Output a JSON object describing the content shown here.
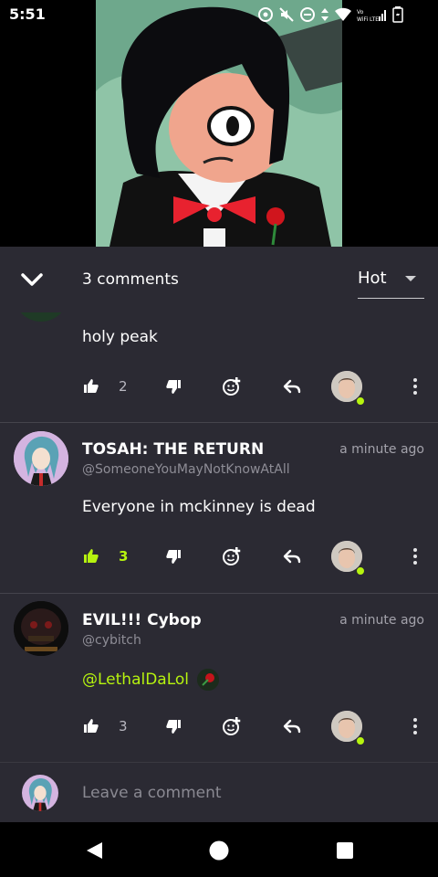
{
  "status_bar": {
    "time": "5:51"
  },
  "sheet": {
    "comment_count": "3 comments",
    "sort": {
      "selected": "Hot"
    }
  },
  "comments": [
    {
      "body": "holy peak",
      "likes": "2",
      "liked": false
    },
    {
      "author": "TOSAH: THE RETURN",
      "handle": "@SomeoneYouMayNotKnowAtAll",
      "time": "a minute ago",
      "body": "Everyone in mckinney is dead",
      "likes": "3",
      "liked": true
    },
    {
      "author": "EVIL!!! Cybop",
      "handle": "@cybitch",
      "time": "a minute ago",
      "mention": "@LethalDaLol",
      "likes": "3",
      "liked": false
    }
  ],
  "compose": {
    "placeholder": "Leave a comment"
  },
  "colors": {
    "accent": "#b6f30f",
    "sheet_bg": "#2b2a33",
    "divider": "#45444c"
  },
  "icons": [
    "thumbs-up-icon",
    "thumbs-down-icon",
    "add-reaction-icon",
    "reply-icon",
    "more-icon",
    "chevron-down-icon",
    "back-icon",
    "home-icon",
    "recents-icon"
  ]
}
